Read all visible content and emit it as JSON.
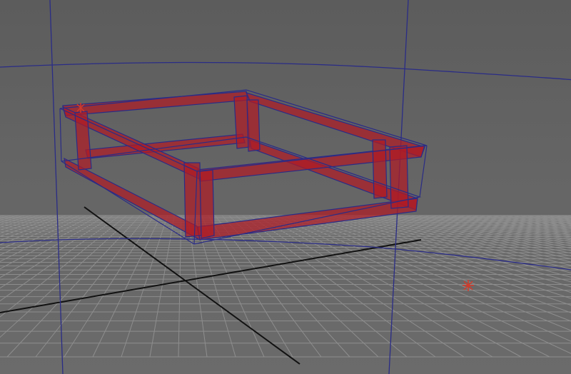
{
  "viewport": {
    "background": "#616161",
    "grid_color": "#9a9a9a",
    "axis_color": "#111111",
    "guide_color": "#2a2c86",
    "frame_fill": "#b11a24",
    "frame_outline": "#2a2c86",
    "pivot_color": "#d23a2a"
  },
  "scene": {
    "object": "rectangular-beam-frame",
    "shading": "x-ray-wireframe",
    "markers": [
      "pivot-marker"
    ]
  }
}
